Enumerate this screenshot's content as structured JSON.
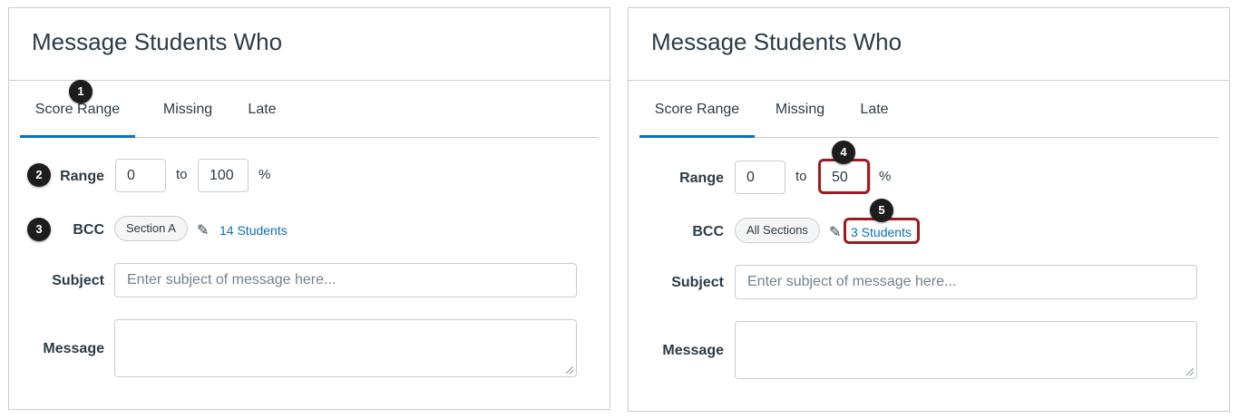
{
  "left": {
    "title": "Message Students Who",
    "tabs": [
      "Score Range",
      "Missing",
      "Late"
    ],
    "range_label": "Range",
    "range_from": "0",
    "range_sep": "to",
    "range_to": "100",
    "range_unit": "%",
    "bcc_label": "BCC",
    "bcc_pill": "Section A",
    "students_link": "14 Students",
    "subject_label": "Subject",
    "subject_placeholder": "Enter subject of message here...",
    "message_label": "Message",
    "badges": [
      "1",
      "2",
      "3"
    ]
  },
  "right": {
    "title": "Message Students Who",
    "tabs": [
      "Score Range",
      "Missing",
      "Late"
    ],
    "range_label": "Range",
    "range_from": "0",
    "range_sep": "to",
    "range_to": "50",
    "range_unit": "%",
    "bcc_label": "BCC",
    "bcc_pill": "All Sections",
    "students_link": "3 Students",
    "subject_label": "Subject",
    "subject_placeholder": "Enter subject of message here...",
    "message_label": "Message",
    "badges": [
      "4",
      "5"
    ]
  },
  "icons": {
    "edit": "pencil-icon"
  },
  "colors": {
    "accent": "#0770c0",
    "highlight": "#9e1c20",
    "badge": "#1d1d1d"
  }
}
